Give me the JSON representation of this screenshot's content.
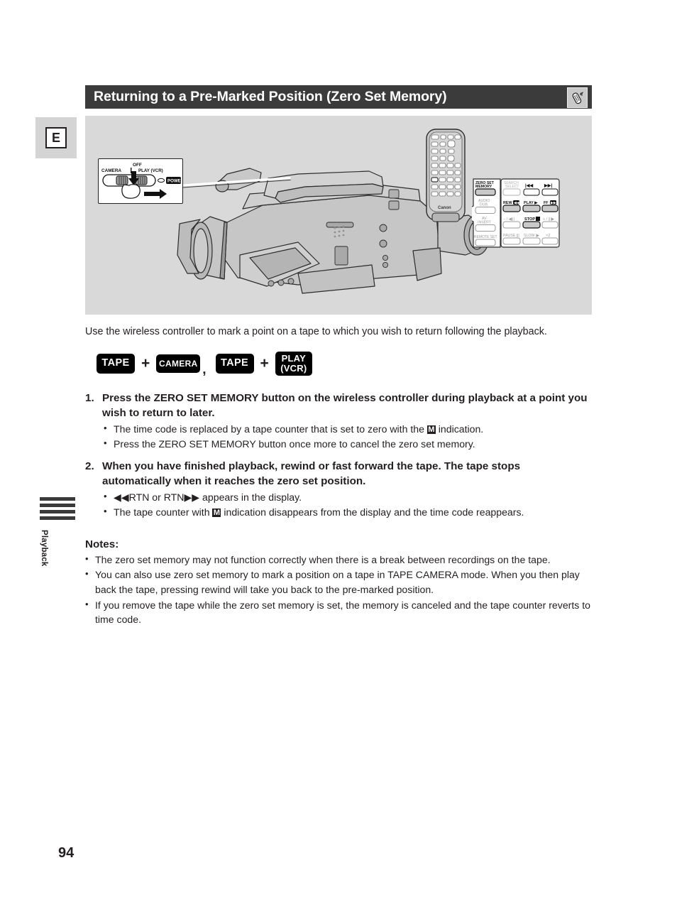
{
  "page": {
    "number": "94",
    "language_tab": "E",
    "chapter_tab": "Playback"
  },
  "header": {
    "title": "Returning to a Pre-Marked Position (Zero Set Memory)",
    "icon": "wireless-remote-icon"
  },
  "illustration": {
    "power_switch": {
      "off_label": "OFF",
      "camera_label": "CAMERA",
      "play_label": "PLAY (VCR)",
      "power_label": "POWER"
    },
    "remote_brand": "Canon",
    "remote_buttons": {
      "zero_set_memory": "ZERO SET\nMEMORY",
      "search_select": "SEARCH\nSELECT",
      "rew_search": "|◀◀",
      "ff_search": "▶▶|",
      "audio_dub": "AUDIO\nDUB.",
      "rew": "REW",
      "play": "PLAY",
      "ff": "FF",
      "av_insert": "AV\nINSERT",
      "minus_slow": "− / ◀|||",
      "stop": "STOP",
      "plus_slow": "+ / |||▶",
      "remote_set": "REMOTE SET",
      "pause": "PAUSE",
      "slow": "SLOW",
      "x2": "×2"
    }
  },
  "intro": "Use the wireless controller to mark a point on a tape to which you wish to return following the playback.",
  "modes": {
    "badge1": "TAPE",
    "plus1": "+",
    "badge2": "CAMERA",
    "separator": ",",
    "badge3": "TAPE",
    "plus2": "+",
    "badge4_line1": "PLAY",
    "badge4_line2": "(VCR)"
  },
  "steps": [
    {
      "number": "1.",
      "heading": "Press the ZERO SET MEMORY button on the wireless controller during playback at a point you wish to return to later.",
      "bullets": [
        {
          "before": "The time code is replaced by a tape counter that is set to zero with the ",
          "symbol": "M",
          "after": " indication."
        },
        {
          "before": "Press the ZERO SET MEMORY button once more to cancel the zero set memory.",
          "symbol": "",
          "after": ""
        }
      ]
    },
    {
      "number": "2.",
      "heading": "When you have finished playback, rewind or fast forward the tape. The tape stops automatically when it reaches the zero set position.",
      "bullets": [
        {
          "before": "◀◀RTN or RTN▶▶ appears in the display.",
          "symbol": "",
          "after": ""
        },
        {
          "before": "The tape counter with ",
          "symbol": "M",
          "after": " indication disappears from the display and the time code reappears."
        }
      ]
    }
  ],
  "notes": {
    "title": "Notes:",
    "items": [
      "The zero set memory may not function correctly when there is a break between recordings on the tape.",
      "You can also use zero set memory to mark a position on a tape in TAPE CAMERA mode. When you then play back the tape, pressing rewind will take you back to the pre-marked position.",
      "If you remove the tape while the zero set memory is set, the memory is canceled and the tape counter reverts to time code."
    ]
  },
  "colors": {
    "title_bar_bg": "#3b3b3b",
    "illustration_bg": "#d9d9d9",
    "tab_bg": "#d4d4d4",
    "text": "#231f20",
    "badge_bg": "#000000"
  }
}
